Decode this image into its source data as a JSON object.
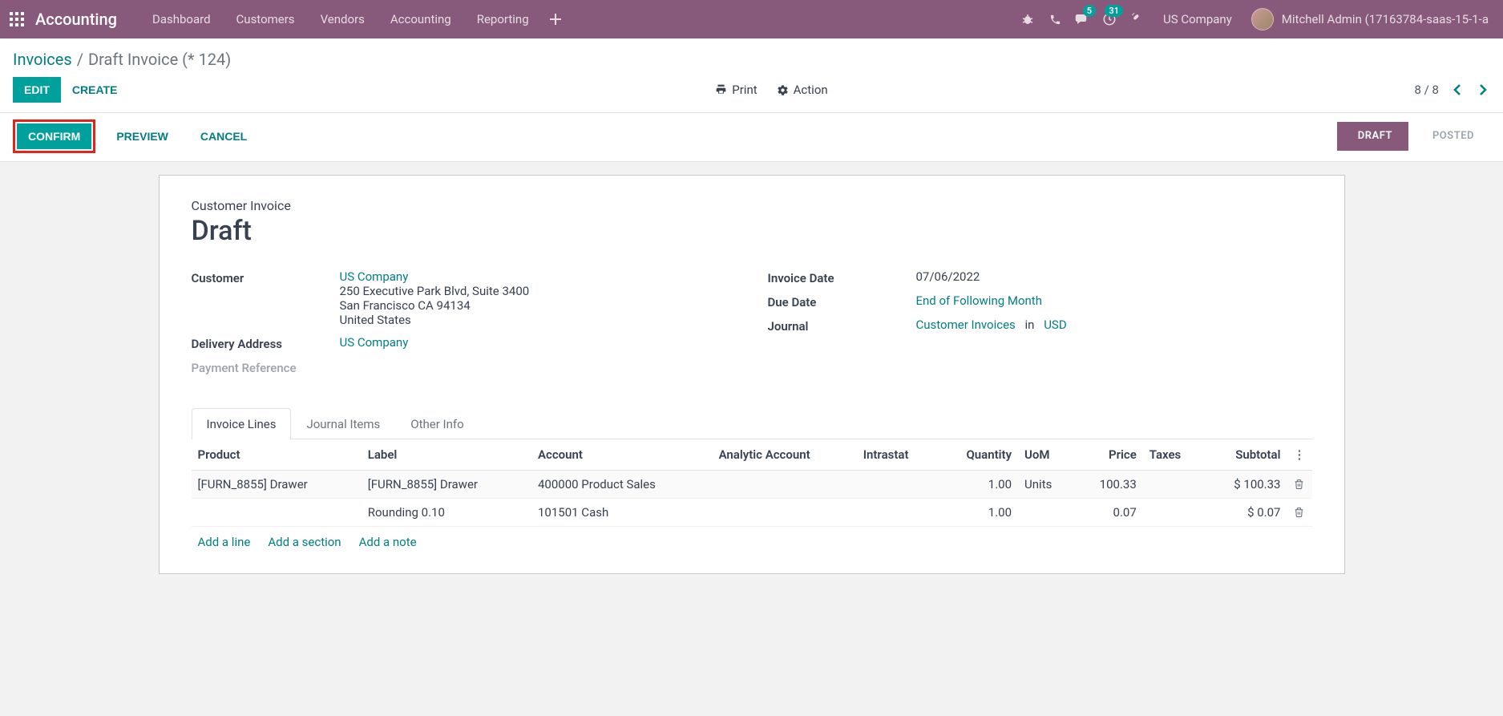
{
  "nav": {
    "brand": "Accounting",
    "items": [
      "Dashboard",
      "Customers",
      "Vendors",
      "Accounting",
      "Reporting"
    ],
    "messages_badge": "5",
    "activities_badge": "31",
    "company": "US Company",
    "user": "Mitchell Admin (17163784-saas-15-1-a"
  },
  "breadcrumb": {
    "root": "Invoices",
    "current": "Draft Invoice (* 124)"
  },
  "toolbar": {
    "edit": "EDIT",
    "create": "CREATE",
    "print": "Print",
    "action": "Action",
    "pager": "8 / 8"
  },
  "statusbar": {
    "confirm": "CONFIRM",
    "preview": "PREVIEW",
    "cancel": "CANCEL",
    "draft": "DRAFT",
    "posted": "POSTED"
  },
  "doc": {
    "type": "Customer Invoice",
    "title": "Draft",
    "customer_label": "Customer",
    "customer_name": "US Company",
    "customer_addr1": "250 Executive Park Blvd, Suite 3400",
    "customer_addr2": "San Francisco CA 94134",
    "customer_addr3": "United States",
    "delivery_label": "Delivery Address",
    "delivery_value": "US Company",
    "payment_ref_label": "Payment Reference",
    "invoice_date_label": "Invoice Date",
    "invoice_date": "07/06/2022",
    "due_date_label": "Due Date",
    "due_date": "End of Following Month",
    "journal_label": "Journal",
    "journal_value": "Customer Invoices",
    "journal_in": "in",
    "journal_currency": "USD"
  },
  "tabs": {
    "invoice_lines": "Invoice Lines",
    "journal_items": "Journal Items",
    "other_info": "Other Info"
  },
  "table": {
    "headers": {
      "product": "Product",
      "label": "Label",
      "account": "Account",
      "analytic": "Analytic Account",
      "intrastat": "Intrastat",
      "quantity": "Quantity",
      "uom": "UoM",
      "price": "Price",
      "taxes": "Taxes",
      "subtotal": "Subtotal"
    },
    "rows": [
      {
        "product": "[FURN_8855] Drawer",
        "label": "[FURN_8855] Drawer",
        "account": "400000 Product Sales",
        "analytic": "",
        "intrastat": "",
        "quantity": "1.00",
        "uom": "Units",
        "price": "100.33",
        "taxes": "",
        "subtotal": "$ 100.33"
      },
      {
        "product": "",
        "label": "Rounding 0.10",
        "account": "101501 Cash",
        "analytic": "",
        "intrastat": "",
        "quantity": "1.00",
        "uom": "",
        "price": "0.07",
        "taxes": "",
        "subtotal": "$ 0.07"
      }
    ],
    "add_line": "Add a line",
    "add_section": "Add a section",
    "add_note": "Add a note"
  }
}
